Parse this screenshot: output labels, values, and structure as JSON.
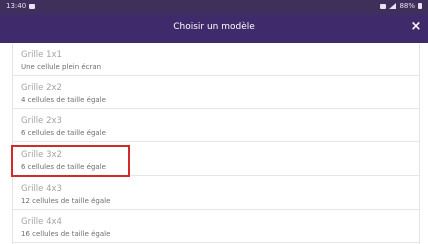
{
  "status_bar": {
    "time": "13:40",
    "battery": "88%"
  },
  "header": {
    "title": "Choisir un modèle",
    "close_label": "×"
  },
  "templates": [
    {
      "title": "Grille 1x1",
      "description": "Une cellule plein écran"
    },
    {
      "title": "Grille 2x2",
      "description": "4 cellules de taille égale"
    },
    {
      "title": "Grille 2x3",
      "description": "6 cellules de taille égale"
    },
    {
      "title": "Grille 3x2",
      "description": "6 cellules de taille égale"
    },
    {
      "title": "Grille 4x3",
      "description": "12 cellules de taille égale"
    },
    {
      "title": "Grille 4x4",
      "description": "16 cellules de taille égale"
    }
  ],
  "colors": {
    "header_bg": "#3f2b6b",
    "highlight": "#d22a2a"
  }
}
